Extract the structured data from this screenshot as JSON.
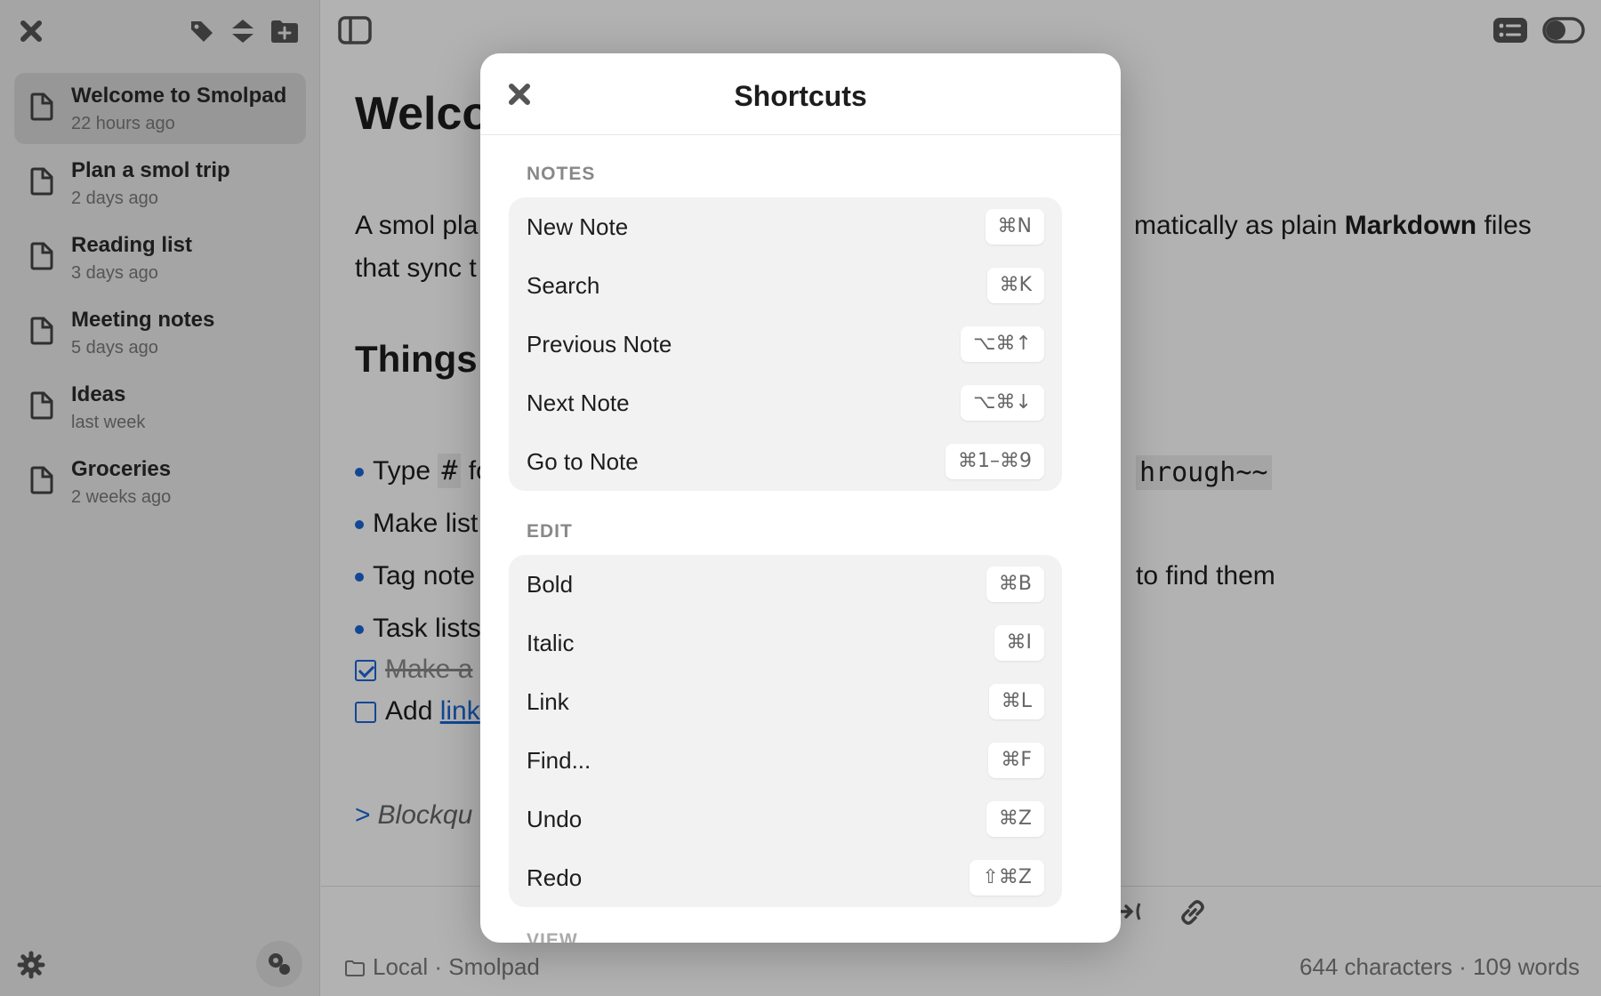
{
  "sidebar": {
    "notes": [
      {
        "title": "Welcome to Smolpad",
        "time": "22 hours ago"
      },
      {
        "title": "Plan a smol trip",
        "time": "2 days ago"
      },
      {
        "title": "Reading list",
        "time": "3 days ago"
      },
      {
        "title": "Meeting notes",
        "time": "5 days ago"
      },
      {
        "title": "Ideas",
        "time": "last week"
      },
      {
        "title": "Groceries",
        "time": "2 weeks ago"
      }
    ]
  },
  "editor": {
    "title": "Welco",
    "para_start": "A smol pla",
    "para_line2": "that sync t",
    "para_right": "matically as plain ",
    "para_bold": "Markdown",
    "para_end": " files",
    "heading": "Things",
    "bullet1": "Type ",
    "bullet1_code": "#",
    "bullet1_tail": " fo",
    "bullet1_right": "hrough~~",
    "bullet2": "Make list",
    "bullet3": "Tag note",
    "bullet3_right": "to find them",
    "bullet4": "Task lists",
    "task1": "Make a",
    "task2": "Add ",
    "task2_link": "link",
    "quote_mark": ">",
    "quote": "Blockqu"
  },
  "status": {
    "location": "Local · Smolpad",
    "counts": "644 characters · 109 words"
  },
  "modal": {
    "title": "Shortcuts",
    "sections": [
      {
        "label": "NOTES",
        "rows": [
          {
            "label": "New Note",
            "keys": "⌘N"
          },
          {
            "label": "Search",
            "keys": "⌘K"
          },
          {
            "label": "Previous Note",
            "keys": "⌥⌘↑"
          },
          {
            "label": "Next Note",
            "keys": "⌥⌘↓"
          },
          {
            "label": "Go to Note",
            "keys": "⌘1–⌘9"
          }
        ]
      },
      {
        "label": "EDIT",
        "rows": [
          {
            "label": "Bold",
            "keys": "⌘B"
          },
          {
            "label": "Italic",
            "keys": "⌘I"
          },
          {
            "label": "Link",
            "keys": "⌘L"
          },
          {
            "label": "Find...",
            "keys": "⌘F"
          },
          {
            "label": "Undo",
            "keys": "⌘Z"
          },
          {
            "label": "Redo",
            "keys": "⇧⌘Z"
          }
        ]
      }
    ],
    "next_section_peek": "VIEW"
  }
}
